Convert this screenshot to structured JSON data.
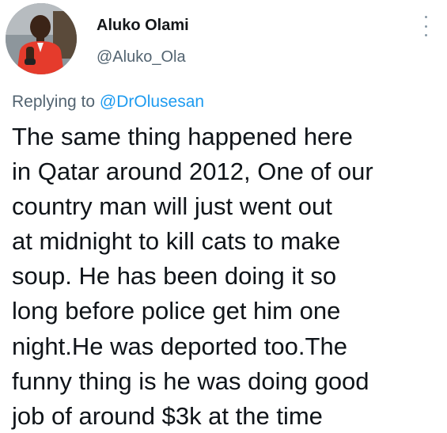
{
  "author": {
    "display_name": "Aluko Olami",
    "handle": "@Aluko_Ola",
    "avatar_icon": "profile-avatar"
  },
  "menu": {
    "icon": "more-vertical-icon"
  },
  "reply_context": {
    "prefix": "Replying to ",
    "mention": "@DrOlusesan"
  },
  "tweet": {
    "lines": [
      "The same thing happened here",
      "in Qatar around 2012, One of our",
      "country man will just went out",
      "at midnight to kill cats to make",
      "soup. He has been doing it so",
      "long before police get him one",
      "night.He was deported too.The",
      "funny thing is he was doing good",
      "job of around $3k at the time"
    ]
  },
  "colors": {
    "text": "#0f1419",
    "secondary": "#536471",
    "link": "#1d9bf0",
    "background": "#ffffff"
  }
}
